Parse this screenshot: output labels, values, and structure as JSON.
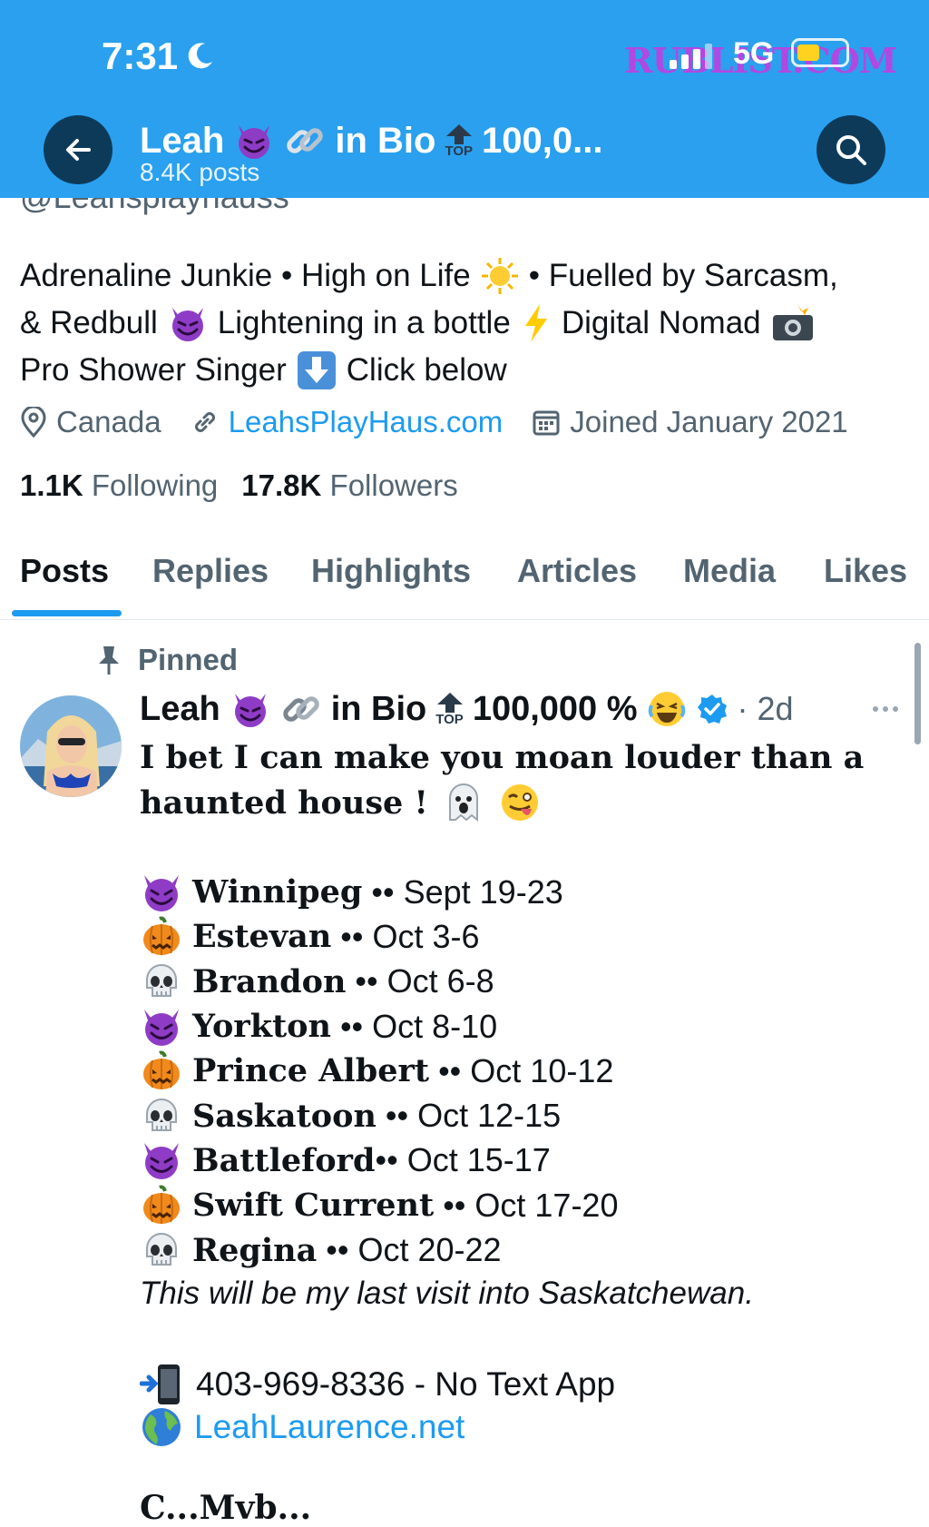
{
  "status_bar": {
    "time": "7:31",
    "network": "5G",
    "watermark": "RUBLIST.COM"
  },
  "header": {
    "name": "Leah",
    "in_bio": "in Bio",
    "top_badge": "TOP",
    "truncated_count": "100,0...",
    "posts_count": "8.4K posts"
  },
  "profile": {
    "handle_partial": "@Leahsplayhauss",
    "bio_lines": [
      [
        "Adrenaline Junkie • High on Life",
        "• Fuelled by Sarcasm,"
      ],
      [
        "& Redbull",
        "Lightening in a bottle",
        "Digital Nomad"
      ],
      [
        "Pro Shower Singer",
        "Click below"
      ]
    ],
    "location": "Canada",
    "website": "LeahsPlayHaus.com",
    "joined": "Joined January 2021",
    "following_count": "1.1K",
    "following_label": "Following",
    "followers_count": "17.8K",
    "followers_label": "Followers"
  },
  "tabs": [
    "Posts",
    "Replies",
    "Highlights",
    "Articles",
    "Media",
    "Likes"
  ],
  "post": {
    "pinned_label": "Pinned",
    "author": "Leah",
    "in_bio": "in Bio",
    "top_badge": "TOP",
    "count": "100,000 %",
    "age": "· 2d",
    "text_line1": "I bet I can make you moan louder than a",
    "text_line2": "haunted house !",
    "cities": [
      {
        "icon": "devil",
        "name": "Winnipeg",
        "dates": " •• Sept 19-23"
      },
      {
        "icon": "pumpkin",
        "name": "Estevan",
        "dates": " •• Oct 3-6"
      },
      {
        "icon": "skull",
        "name": "Brandon",
        "dates": " •• Oct 6-8"
      },
      {
        "icon": "devil",
        "name": "Yorkton",
        "dates": " •• Oct 8-10"
      },
      {
        "icon": "pumpkin",
        "name": "Prince Albert",
        "dates": " •• Oct 10-12"
      },
      {
        "icon": "skull",
        "name": "Saskatoon",
        "dates": " •• Oct 12-15"
      },
      {
        "icon": "devil",
        "name": "Battleford",
        "dates": "•• Oct 15-17"
      },
      {
        "icon": "pumpkin",
        "name": "Swift Current",
        "dates": " •• Oct 17-20"
      },
      {
        "icon": "skull",
        "name": "Regina",
        "dates": " •• Oct 20-22"
      }
    ],
    "closing": "This will be my last visit into Saskatchewan.",
    "phone": "403-969-8336 - No Text App",
    "site": "LeahLaurence.net",
    "cutoff": "C...Mvb..."
  },
  "colors": {
    "header_bg": "#2aa0ef",
    "accent": "#1d9bf0",
    "text": "#0f1419",
    "muted": "#536471"
  }
}
